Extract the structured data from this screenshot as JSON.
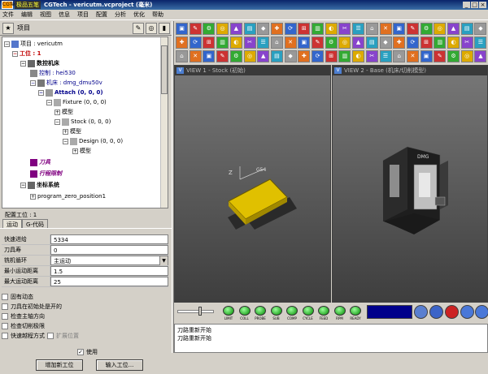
{
  "window": {
    "title": "CGTech - vericutm.vcproject (毫米)",
    "ime_label": "极品五笔",
    "app_icon": "CGTech"
  },
  "menu": [
    "文件",
    "编辑",
    "视图",
    "信息",
    "项目",
    "配置",
    "分析",
    "优化",
    "帮助"
  ],
  "project_panel": {
    "header_label": "项目"
  },
  "tree": [
    {
      "label": "项目 : vericutm",
      "style": "plain"
    },
    {
      "label": "工位 : 1",
      "style": "red"
    },
    {
      "label": "数控机床",
      "style": "bold"
    },
    {
      "label": "控制 : hei530",
      "style": "blue"
    },
    {
      "label": "机床 : dmg_dmu50v",
      "style": "blue"
    },
    {
      "label": "Attach (0, 0, 0)",
      "style": "blue"
    },
    {
      "label": "Fixture (0, 0, 0)",
      "style": "plain"
    },
    {
      "label": "模型",
      "style": "plain"
    },
    {
      "label": "Stock (0, 0, 0)",
      "style": "plain"
    },
    {
      "label": "模型",
      "style": "plain"
    },
    {
      "label": "Design (0, 0, 0)",
      "style": "plain"
    },
    {
      "label": "模型",
      "style": "plain"
    },
    {
      "label": "刀具",
      "style": "purple"
    },
    {
      "label": "行程限制",
      "style": "purple"
    },
    {
      "label": "坐标系统",
      "style": "bold"
    },
    {
      "label": "program_zero_position1",
      "style": "plain"
    }
  ],
  "config": {
    "title": "配置工位 : 1",
    "tabs": [
      "运动",
      "G-代码"
    ],
    "fields": [
      {
        "label": "快速进给",
        "value": "5334",
        "dropdown": false
      },
      {
        "label": "刀具寿",
        "value": "0",
        "dropdown": false
      },
      {
        "label": "铣机循环",
        "value": "主运动",
        "dropdown": true
      },
      {
        "label": "最小运动距离",
        "value": "1.5",
        "dropdown": false
      },
      {
        "label": "最大运动距离",
        "value": "25",
        "dropdown": false
      }
    ],
    "checkboxes": [
      {
        "label": "固有动态",
        "checked": false,
        "grey": false
      },
      {
        "label": "刀具在初始处是开的",
        "checked": false,
        "grey": false
      },
      {
        "label": "检查主轴方向",
        "checked": false,
        "grey": false
      },
      {
        "label": "检查切削极限",
        "checked": false,
        "grey": false
      },
      {
        "label": "快速越程方式",
        "checked": false,
        "grey": false
      }
    ],
    "checkbox_extra": "扩展位置",
    "use_label": "使用",
    "add_button": "增加新工位",
    "insert_button": "输入工位..."
  },
  "views": [
    {
      "title": "VIEW 1 - Stock (初始)",
      "icon": "V"
    },
    {
      "title": "VIEW 2 - Base (机床/切削模型)",
      "icon": "V"
    }
  ],
  "view1_labels": {
    "axis": "Z",
    "marker": "G54"
  },
  "view2_labels": {
    "marker": "DMG"
  },
  "sim_leds": [
    "LIMIT",
    "COLL",
    "PROBE",
    "SUB",
    "COMP",
    "CYCLE",
    "FEED",
    "RPM",
    "READY"
  ],
  "log_lines": [
    "刀路重新开始",
    "刀路重新开始"
  ],
  "colors": {
    "stock": "#d4b000",
    "led_on": "#22aa22",
    "progress": "#00008b",
    "titlebar": "#0a246a"
  }
}
